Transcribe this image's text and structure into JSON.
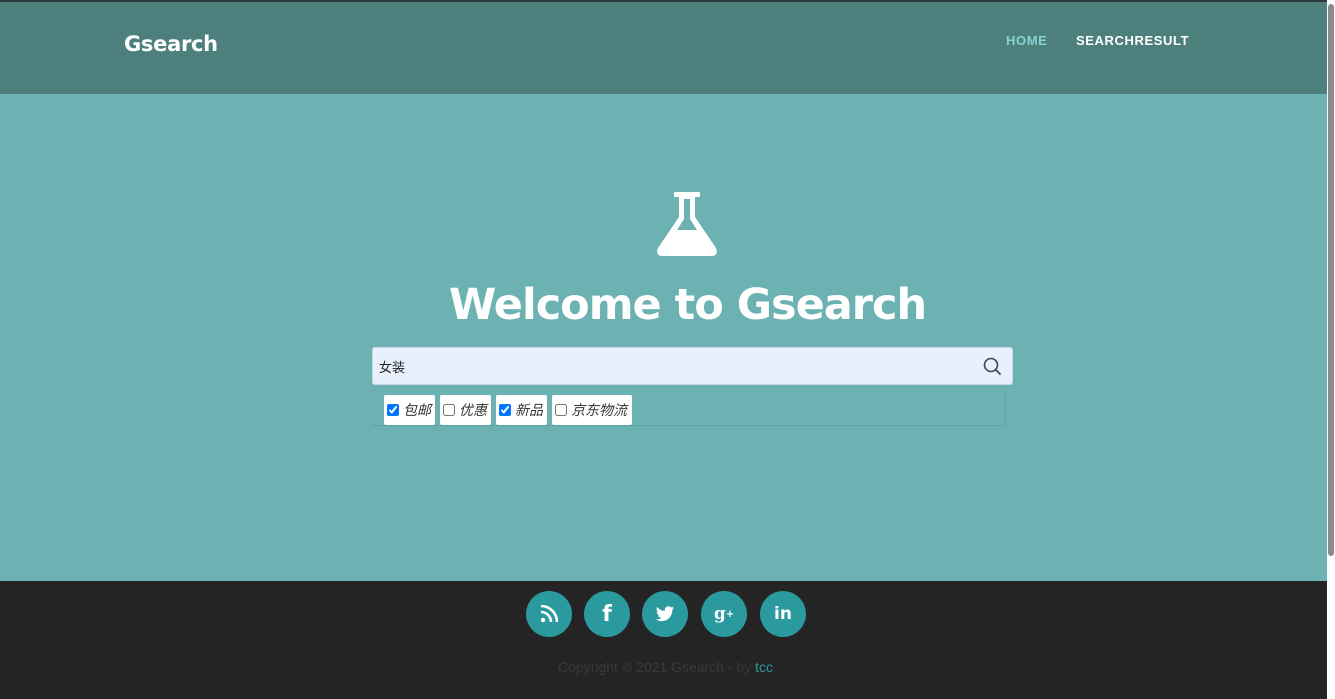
{
  "navbar": {
    "brand": "Gsearch",
    "links": [
      {
        "label": "HOME",
        "active": true
      },
      {
        "label": "SEARCHRESULT",
        "active": false
      }
    ]
  },
  "hero": {
    "icon": "flask-icon",
    "title": "Welcome to Gsearch"
  },
  "search": {
    "value": "女装",
    "button_icon": "search-icon"
  },
  "filters": [
    {
      "label": "包邮",
      "checked": true
    },
    {
      "label": "优惠",
      "checked": false
    },
    {
      "label": "新品",
      "checked": true
    },
    {
      "label": "京东物流",
      "checked": false
    }
  ],
  "footer": {
    "social": [
      "rss-icon",
      "facebook-icon",
      "twitter-icon",
      "google-plus-icon",
      "linkedin-icon"
    ],
    "copyright_text": "Copyright © 2021 Gsearch - by ",
    "author": "tcc"
  },
  "colors": {
    "navbar": "#4d7f7d",
    "hero": "#6cb2b2",
    "footer": "#242424",
    "accent": "#2a9a9f"
  }
}
